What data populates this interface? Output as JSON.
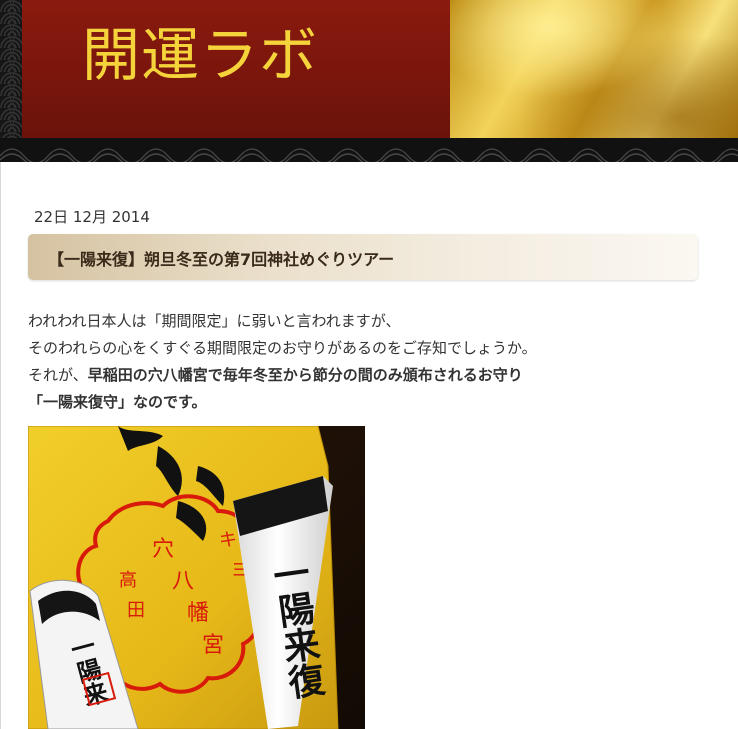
{
  "header": {
    "site_title": "開運ラボ"
  },
  "post": {
    "date": "22日 12月 2014",
    "title": "【一陽来復】朔旦冬至の第7回神社めぐりツアー",
    "line1": "われわれ日本人は「期間限定」に弱いと言われますが、",
    "line2": "そのわれらの心をくすぐる期間限定のお守りがあるのをご存知でしょうか。",
    "line3_prefix": "それが、",
    "line3_bold": "早稲田の穴八幡宮で毎年冬至から節分の間のみ頒布されるお守り",
    "line4_bold": "「一陽来復守」なのです。"
  },
  "photo": {
    "stamp_chars": [
      "穴",
      "八",
      "幡",
      "宮"
    ],
    "stamp_side_left": [
      "高",
      "田"
    ],
    "stamp_side_right": [
      "キ",
      "ヨ"
    ],
    "talisman_text": "一陽来復",
    "small_talisman_text": "一陽来"
  },
  "colors": {
    "banner_red": "#7a160c",
    "title_yellow": "#f5d33b",
    "stamp_red": "#d81a0a",
    "paper_yellow": "#e9c01a"
  }
}
